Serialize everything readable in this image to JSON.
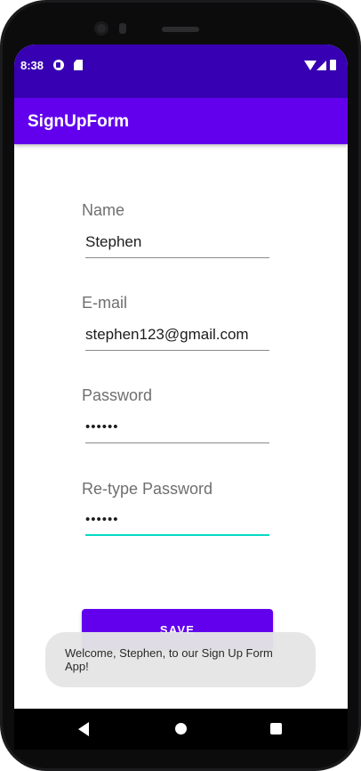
{
  "status_bar": {
    "time": "8:38",
    "icons": [
      "notification-icon",
      "sd-card-icon",
      "wifi-icon",
      "signal-icon",
      "battery-icon"
    ]
  },
  "app_bar": {
    "title": "SignUpForm"
  },
  "form": {
    "name_label": "Name",
    "name_value": "Stephen",
    "email_label": "E-mail",
    "email_value": "stephen123@gmail.com",
    "password_label": "Password",
    "password_value": "••••••",
    "retype_label": "Re-type Password",
    "retype_value": "••••••",
    "save_label": "SAVE"
  },
  "toast": {
    "message": "Welcome, Stephen, to our Sign Up Form App!"
  },
  "nav_bar": {
    "icons": [
      "back-icon",
      "home-icon",
      "recents-icon"
    ]
  },
  "colors": {
    "primary": "#6200ee",
    "primary_dark": "#3700b3",
    "accent": "#03dac5"
  }
}
